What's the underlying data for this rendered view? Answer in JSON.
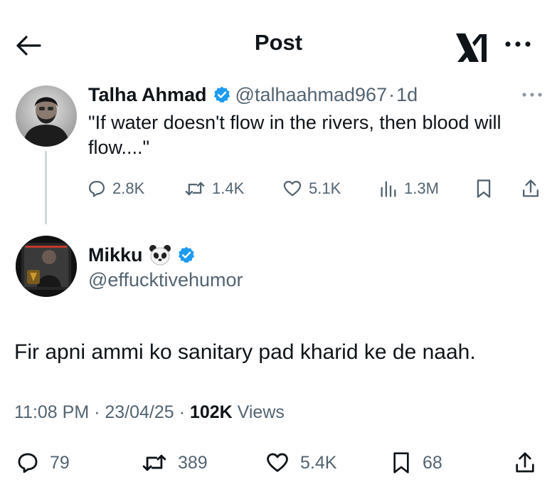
{
  "header": {
    "back_icon": "arrow-left-icon",
    "title": "Post",
    "logo_icon": "x-logo-icon",
    "more_icon": "more-horizontal-icon"
  },
  "parent_tweet": {
    "author_name": "Talha Ahmad",
    "verified_icon": "verified-badge-icon",
    "handle": "@talhaahmad967",
    "separator": "·",
    "time": "1d",
    "text": "\"If water doesn't flow in the rivers, then blood will flow....\"",
    "more_icon": "more-horizontal-icon",
    "actions": {
      "replies": "2.8K",
      "reposts": "1.4K",
      "likes": "5.1K",
      "views": "1.3M",
      "bookmark_icon": "bookmark-icon",
      "share_icon": "share-icon"
    }
  },
  "reply_tweet": {
    "author_name": "Mikku",
    "name_emoji": "🐼",
    "verified_icon": "verified-badge-icon",
    "handle": "@effucktivehumor",
    "text": "Fir apni ammi ko sanitary pad kharid ke de naah.",
    "meta": {
      "time": "11:08 PM",
      "date": "23/04/25",
      "sep1": " · ",
      "sep2": " · ",
      "views_count": "102K",
      "views_label": " Views"
    },
    "actions": {
      "replies": "79",
      "reposts": "389",
      "likes": "5.4K",
      "bookmarks": "68",
      "share_icon": "share-icon"
    }
  },
  "colors": {
    "text": "#0f1419",
    "secondary": "#536471",
    "verified": "#1d9bf0",
    "thread_line": "#cfd9de"
  }
}
